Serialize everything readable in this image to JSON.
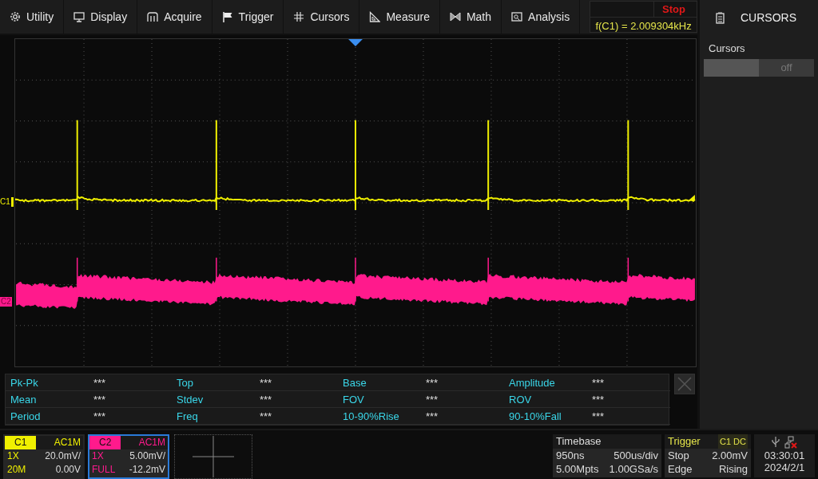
{
  "menu": [
    {
      "label": "Utility"
    },
    {
      "label": "Display"
    },
    {
      "label": "Acquire"
    },
    {
      "label": "Trigger"
    },
    {
      "label": "Cursors"
    },
    {
      "label": "Measure"
    },
    {
      "label": "Math"
    },
    {
      "label": "Analysis"
    }
  ],
  "status": {
    "run_state": "Stop",
    "frequency": "f(C1) = 2.009304kHz"
  },
  "right_panel": {
    "title": "CURSORS",
    "settings": [
      {
        "label": "Cursors",
        "value": "off",
        "on": false
      }
    ]
  },
  "plot": {
    "markers": [
      {
        "label": "C1",
        "color": "#f0f000"
      },
      {
        "label": "C2",
        "color": "#ff1a8c"
      }
    ]
  },
  "measurements": [
    {
      "name": "Pk-Pk",
      "value": "***"
    },
    {
      "name": "Top",
      "value": "***"
    },
    {
      "name": "Base",
      "value": "***"
    },
    {
      "name": "Amplitude",
      "value": "***"
    },
    {
      "name": "Mean",
      "value": "***"
    },
    {
      "name": "Stdev",
      "value": "***"
    },
    {
      "name": "FOV",
      "value": "***"
    },
    {
      "name": "ROV",
      "value": "***"
    },
    {
      "name": "Period",
      "value": "***"
    },
    {
      "name": "Freq",
      "value": "***"
    },
    {
      "name": "10-90%Rise",
      "value": "***"
    },
    {
      "name": "90-10%Fall",
      "value": "***"
    }
  ],
  "channels": [
    {
      "label": "C1",
      "coupling": "AC1M",
      "probe": "1X",
      "scale": "20.0mV/",
      "bandwidth": "20M",
      "offset": "0.00V",
      "color": "#f0f000",
      "selected": false
    },
    {
      "label": "C2",
      "coupling": "AC1M",
      "probe": "1X",
      "scale": "5.00mV/",
      "bandwidth": "FULL",
      "offset": "-12.2mV",
      "color": "#ff1a8c",
      "selected": true
    }
  ],
  "timebase": {
    "title": "Timebase",
    "delay": "950ns",
    "scale": "500us/div",
    "memory": "5.00Mpts",
    "sample_rate": "1.00GSa/s"
  },
  "trigger": {
    "title": "Trigger",
    "source": "C1 DC",
    "state": "Stop",
    "level": "2.00mV",
    "type": "Edge",
    "slope": "Rising"
  },
  "clock": {
    "time": "03:30:01",
    "date": "2024/2/1"
  }
}
